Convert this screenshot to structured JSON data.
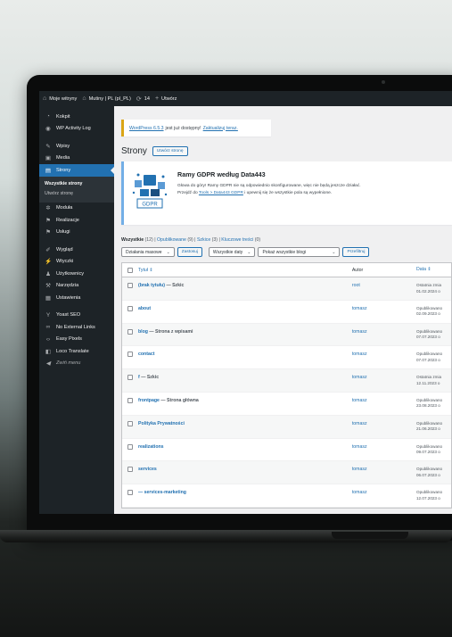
{
  "admin_bar": {
    "site_name": "Moje witryny",
    "blog_name": "Mutiny | PL (pl_PL)",
    "updates_count": "14",
    "new_label": "Utwórz"
  },
  "sidebar": {
    "items": [
      {
        "label": "Kokpit",
        "icon": "dashboard-icon"
      },
      {
        "label": "WP Activity Log",
        "icon": "activity-log-icon"
      },
      {
        "label": "Wpisy",
        "icon": "pin-icon"
      },
      {
        "label": "Media",
        "icon": "media-icon"
      },
      {
        "label": "Strony",
        "icon": "pages-icon"
      },
      {
        "label": "Moduła",
        "icon": "module-icon"
      },
      {
        "label": "Realizacje",
        "icon": "flag-icon"
      },
      {
        "label": "Usługi",
        "icon": "flag-icon"
      },
      {
        "label": "Wygląd",
        "icon": "brush-icon"
      },
      {
        "label": "Wtyczki",
        "icon": "plugin-icon"
      },
      {
        "label": "Użytkownicy",
        "icon": "users-icon"
      },
      {
        "label": "Narzędzia",
        "icon": "tools-icon"
      },
      {
        "label": "Ustawienia",
        "icon": "settings-icon"
      },
      {
        "label": "Yoast SEO",
        "icon": "yoast-icon"
      },
      {
        "label": "No External Links",
        "icon": "link-icon"
      },
      {
        "label": "Easy Pixels",
        "icon": "code-icon"
      },
      {
        "label": "Loco Translate",
        "icon": "translate-icon"
      },
      {
        "label": "Zwiń menu",
        "icon": "collapse-icon"
      }
    ],
    "submenu": [
      "Wszystkie strony",
      "Utwórz stronę"
    ]
  },
  "notice": {
    "link": "WordPress 6.5.3",
    "text": "jest już dostępny!",
    "update_link": "Zaktualizuj teraz."
  },
  "page": {
    "title": "Strony",
    "add_new": "Utwórz stronę"
  },
  "gdpr": {
    "title": "Ramy GDPR według Data443",
    "line1": "Głowa do góry! Ramy GDPR nie są odpowiednio skonfigurowane, więc nie będą jeszcze działać.",
    "line2_pre": "Przejdź do",
    "line2_link": "Tools > Data443 GDPR",
    "line2_post": "i upewnij się że wszystkie pola są wypełnione.",
    "logo_text": "GDPR",
    "accent": "#2271b1"
  },
  "filters": {
    "all": "Wszystkie",
    "all_count": "(12)",
    "published": "Opublikowane",
    "published_count": "(9)",
    "drafts": "Szkice",
    "drafts_count": "(3)",
    "cornerstone": "Kluczowe treści",
    "cornerstone_count": "(0)"
  },
  "bulk": {
    "action": "Działania masowe",
    "apply": "Zastosuj",
    "dates": "Wszystkie daty",
    "blogs": "Pokaż wszystkie blogi",
    "filter": "Przefiltruj"
  },
  "table": {
    "headers": {
      "title": "Tytuł",
      "author": "Autor",
      "date": "Data"
    },
    "rows": [
      {
        "title": "(brak tytułu)",
        "state": "— Szkic",
        "author": "root",
        "date1": "Ostatnia zmia",
        "date2": "01.02.2024 o"
      },
      {
        "title": "about",
        "state": "",
        "author": "tomasz",
        "date1": "Opublikowano",
        "date2": "02.09.2023 o"
      },
      {
        "title": "blog",
        "state": "— Strona z wpisami",
        "author": "tomasz",
        "date1": "Opublikowano",
        "date2": "07.07.2023 o"
      },
      {
        "title": "contact",
        "state": "",
        "author": "tomasz",
        "date1": "Opublikowano",
        "date2": "07.07.2023 o"
      },
      {
        "title": "f",
        "state": "— Szkic",
        "author": "tomasz",
        "date1": "Ostatnia zmia",
        "date2": "12.11.2023 o"
      },
      {
        "title": "frontpage",
        "state": "— Strona główna",
        "author": "tomasz",
        "date1": "Opublikowano",
        "date2": "23.08.2023 o"
      },
      {
        "title": "Polityka Prywatności",
        "state": "",
        "author": "tomasz",
        "date1": "Opublikowano",
        "date2": "21.06.2023 o"
      },
      {
        "title": "realizations",
        "state": "",
        "author": "tomasz",
        "date1": "Opublikowano",
        "date2": "09.07.2023 o"
      },
      {
        "title": "services",
        "state": "",
        "author": "tomasz",
        "date1": "Opublikowano",
        "date2": "06.07.2023 o"
      },
      {
        "title": "— services-marketing",
        "state": "",
        "author": "tomasz",
        "date1": "Opublikowano",
        "date2": "12.07.2023 o"
      }
    ]
  }
}
